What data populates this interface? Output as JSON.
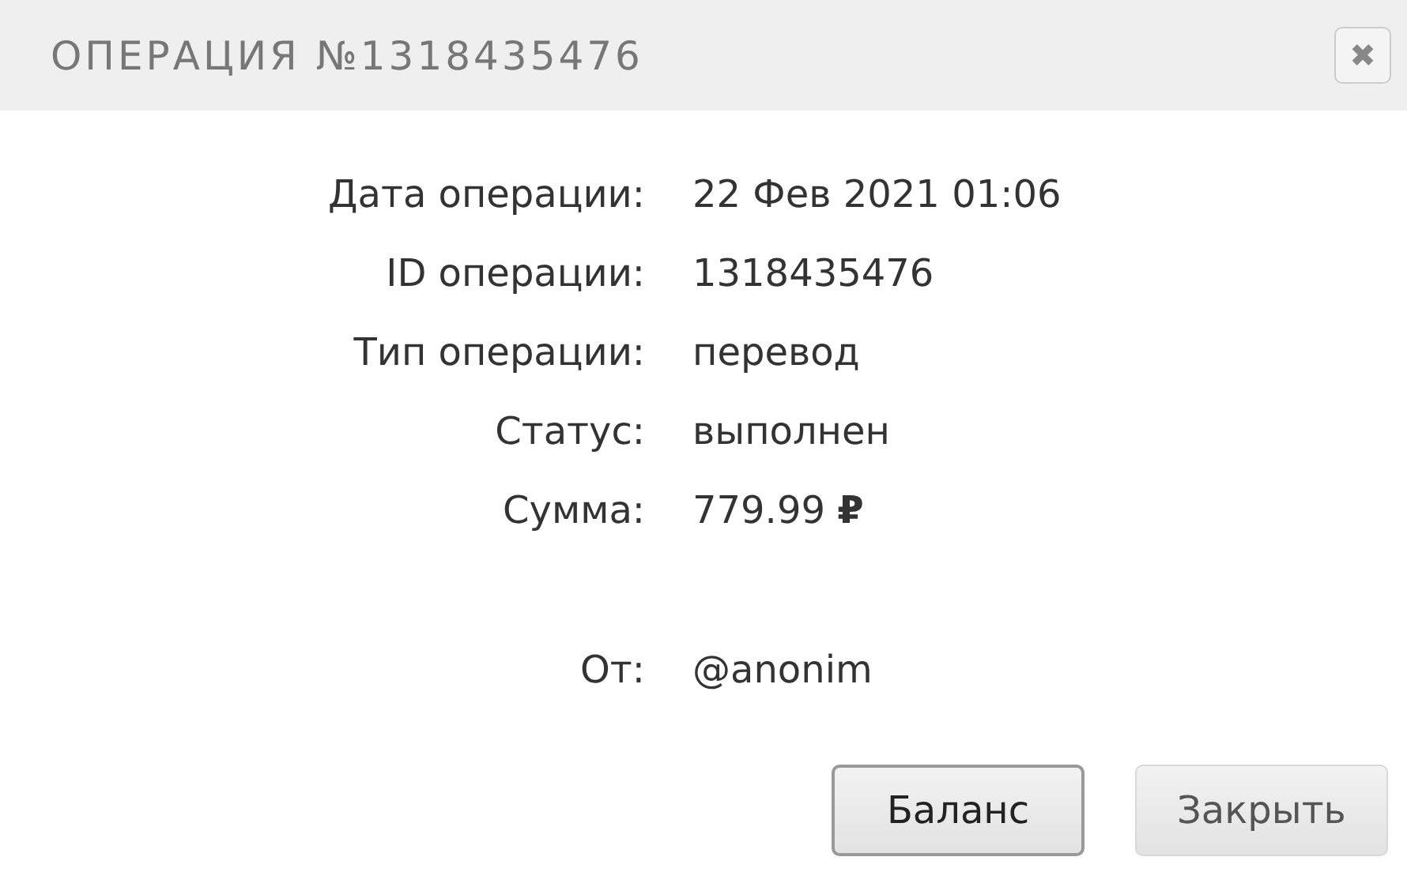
{
  "dialog": {
    "title": "ОПЕРАЦИЯ №1318435476",
    "close_icon": "✖"
  },
  "details": [
    {
      "label": "Дата операции:",
      "value": "22 Фев 2021 01:06"
    },
    {
      "label": "ID операции:",
      "value": "1318435476"
    },
    {
      "label": "Тип операции:",
      "value": "перевод"
    },
    {
      "label": "Статус:",
      "value": "выполнен"
    },
    {
      "label": "Сумма:",
      "value": "779.99 **₽**"
    }
  ],
  "sender": {
    "label": "От:",
    "value": "@anonim"
  },
  "buttons": [
    {
      "label": "Баланс",
      "focused": true
    },
    {
      "label": "Закрыть",
      "focused": false
    }
  ]
}
